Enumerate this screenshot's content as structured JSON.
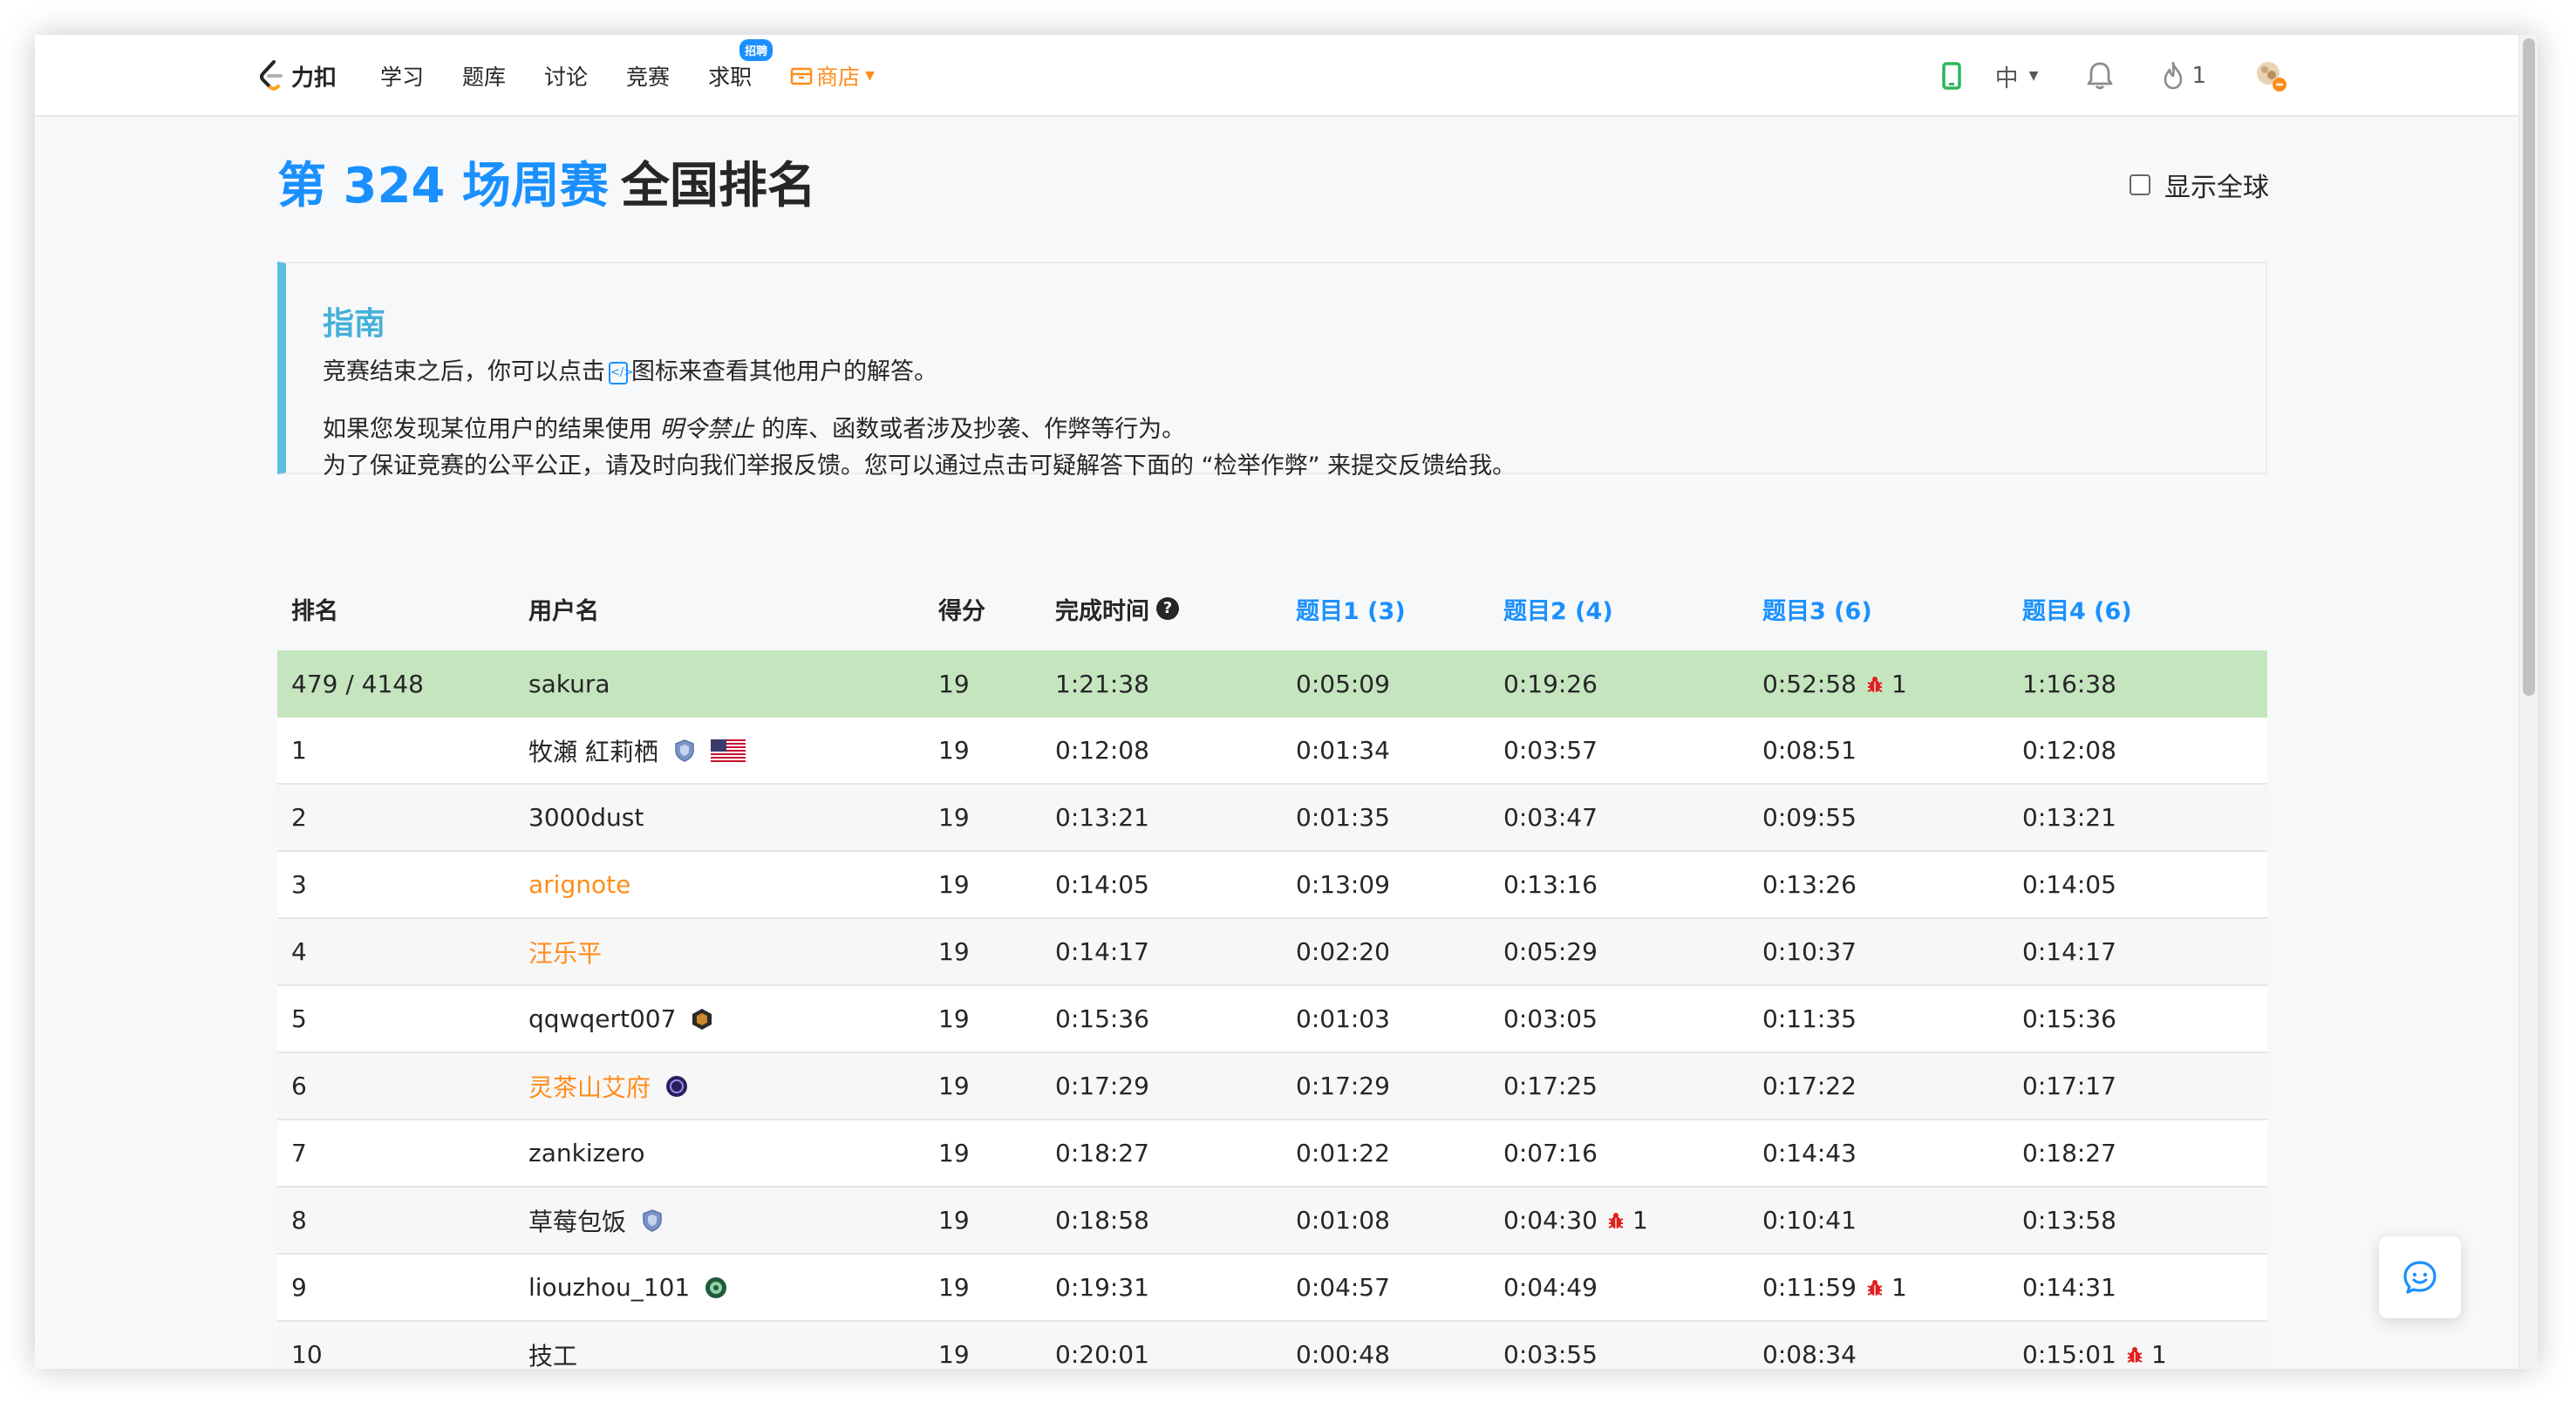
{
  "nav": {
    "logo_text": "力扣",
    "items": [
      {
        "label": "学习"
      },
      {
        "label": "题库"
      },
      {
        "label": "讨论"
      },
      {
        "label": "竞赛"
      },
      {
        "label": "求职",
        "badge": "招聘"
      }
    ],
    "store_label": "商店",
    "lang_label": "中",
    "streak_count": "1",
    "accent_color": "#1a90ff",
    "store_color": "#ff8c1a"
  },
  "header": {
    "title_highlight": "第 324 场周赛",
    "title_rest": "全国排名",
    "show_global_label": "显示全球",
    "show_global_checked": false
  },
  "guide": {
    "title": "指南",
    "line1_before": "竞赛结束之后，你可以点击",
    "line1_after": "图标来查看其他用户的解答。",
    "line2_before": "如果您发现某位用户的结果使用",
    "line2_em": "明令禁止",
    "line2_after": "的库、函数或者涉及抄袭、作弊等行为。",
    "line3": "为了保证竞赛的公平公正，请及时向我们举报反馈。您可以通过点击可疑解答下面的 “检举作弊” 来提交反馈给我。"
  },
  "table": {
    "headers": {
      "rank": "排名",
      "username": "用户名",
      "score": "得分",
      "finish_time": "完成时间",
      "q1": "题目1 (3)",
      "q2": "题目2 (4)",
      "q3": "题目3 (6)",
      "q4": "题目4 (6)"
    },
    "rows": [
      {
        "rank": "479 / 4148",
        "user": "sakura",
        "score": "19",
        "time": "1:21:38",
        "q1": "0:05:09",
        "q2": "0:19:26",
        "q3": "0:52:58",
        "q3_bug": "1",
        "q4": "1:16:38"
      },
      {
        "rank": "1",
        "user": "牧瀬 紅莉栖",
        "score": "19",
        "time": "0:12:08",
        "q1": "0:01:34",
        "q2": "0:03:57",
        "q3": "0:08:51",
        "q4": "0:12:08"
      },
      {
        "rank": "2",
        "user": "3000dust",
        "score": "19",
        "time": "0:13:21",
        "q1": "0:01:35",
        "q2": "0:03:47",
        "q3": "0:09:55",
        "q4": "0:13:21"
      },
      {
        "rank": "3",
        "user": "arignote",
        "score": "19",
        "time": "0:14:05",
        "q1": "0:13:09",
        "q2": "0:13:16",
        "q3": "0:13:26",
        "q4": "0:14:05"
      },
      {
        "rank": "4",
        "user": "汪乐平",
        "score": "19",
        "time": "0:14:17",
        "q1": "0:02:20",
        "q2": "0:05:29",
        "q3": "0:10:37",
        "q4": "0:14:17"
      },
      {
        "rank": "5",
        "user": "qqwqert007",
        "score": "19",
        "time": "0:15:36",
        "q1": "0:01:03",
        "q2": "0:03:05",
        "q3": "0:11:35",
        "q4": "0:15:36"
      },
      {
        "rank": "6",
        "user": "灵茶山艾府",
        "score": "19",
        "time": "0:17:29",
        "q1": "0:17:29",
        "q2": "0:17:25",
        "q3": "0:17:22",
        "q4": "0:17:17"
      },
      {
        "rank": "7",
        "user": "zankizero",
        "score": "19",
        "time": "0:18:27",
        "q1": "0:01:22",
        "q2": "0:07:16",
        "q3": "0:14:43",
        "q4": "0:18:27"
      },
      {
        "rank": "8",
        "user": "草莓包饭",
        "score": "19",
        "time": "0:18:58",
        "q1": "0:01:08",
        "q2": "0:04:30",
        "q2_bug": "1",
        "q3": "0:10:41",
        "q4": "0:13:58"
      },
      {
        "rank": "9",
        "user": "liouzhou_101",
        "score": "19",
        "time": "0:19:31",
        "q1": "0:04:57",
        "q2": "0:04:49",
        "q3": "0:11:59",
        "q3_bug": "1",
        "q4": "0:14:31"
      },
      {
        "rank": "10",
        "user": "技工",
        "score": "19",
        "time": "0:20:01",
        "q1": "0:00:48",
        "q2": "0:03:55",
        "q3": "0:08:34",
        "q4": "0:15:01",
        "q4_bug": "1"
      }
    ],
    "highlight_row_color": "#c5e5bf",
    "orange_user_color": "#ff8c1a",
    "bug_color": "#e02020"
  }
}
